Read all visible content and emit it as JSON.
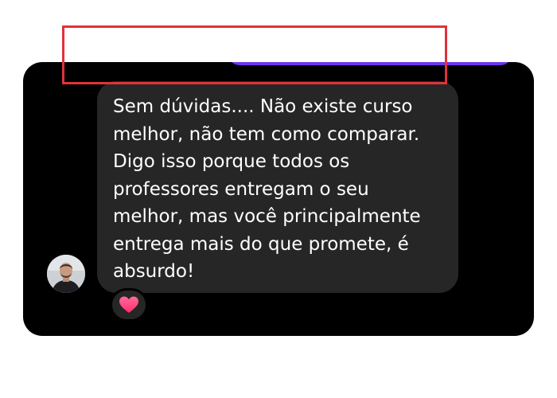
{
  "conversation": {
    "message": {
      "lines": [
        "Sem dúvidas.... Não existe curso",
        "melhor, não tem como comparar.",
        "Digo isso porque todos os",
        "professores entregam o seu",
        "melhor, mas você principalmente",
        "entrega mais do que promete, é",
        "absurdo!"
      ]
    },
    "reaction": {
      "icon": "heart-icon",
      "color": "#ff3a7a"
    },
    "avatar": {
      "icon": "user-avatar-photo"
    }
  },
  "colors": {
    "background": "#000000",
    "received_bubble": "#262626",
    "sent_bubble": "#6c36e8",
    "highlight_outline": "#e0323a",
    "text": "#ffffff"
  }
}
